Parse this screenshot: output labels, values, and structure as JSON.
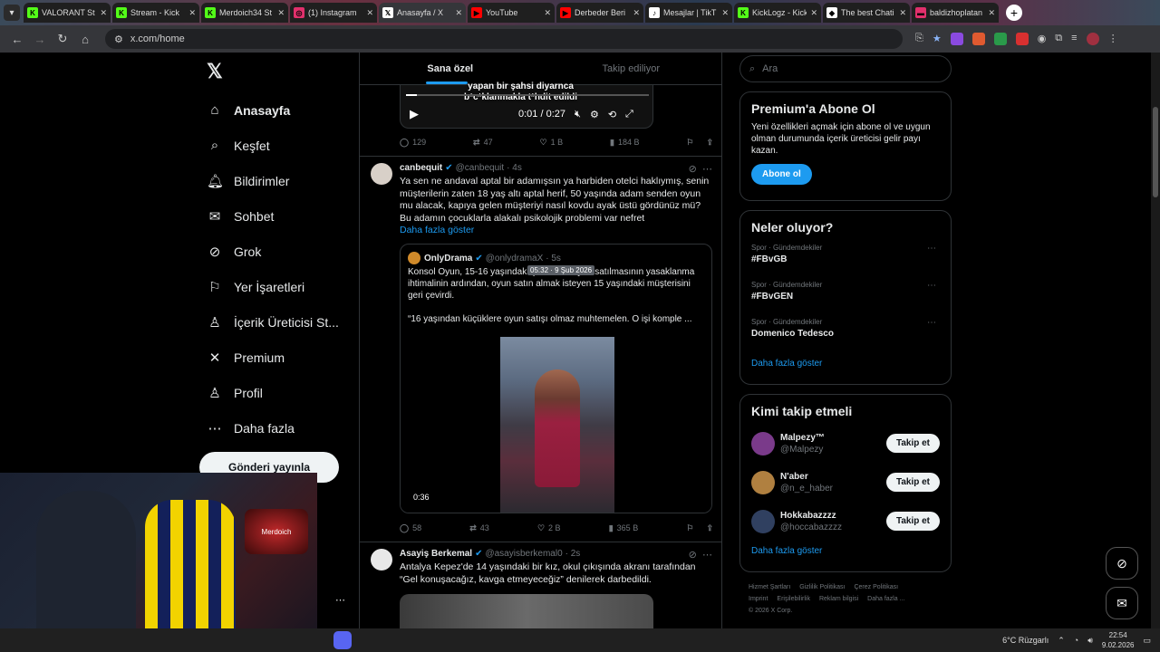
{
  "browser": {
    "tabs": [
      {
        "title": "VALORANT St",
        "color": "#53fc18",
        "glyph": "K",
        "active": false
      },
      {
        "title": "Stream - Kick",
        "color": "#53fc18",
        "glyph": "K",
        "active": false
      },
      {
        "title": "Merdoich34 St",
        "color": "#53fc18",
        "glyph": "K",
        "active": false
      },
      {
        "title": "(1) Instagram",
        "color": "#e1306c",
        "glyph": "◎",
        "active": false
      },
      {
        "title": "Anasayfa / X",
        "color": "#ffffff",
        "glyph": "𝕏",
        "active": true
      },
      {
        "title": "YouTube",
        "color": "#ff0000",
        "glyph": "▶",
        "active": false
      },
      {
        "title": "Derbeder Beri",
        "color": "#ff0000",
        "glyph": "▶",
        "active": false
      },
      {
        "title": "Mesajlar | TikT",
        "color": "#ffffff",
        "glyph": "♪",
        "active": false
      },
      {
        "title": "KickLogz - Kick",
        "color": "#53fc18",
        "glyph": "K",
        "active": false
      },
      {
        "title": "The best Chati",
        "color": "#ffffff",
        "glyph": "◆",
        "active": false
      },
      {
        "title": "baldizhoplatan",
        "color": "#e1306c",
        "glyph": "▬",
        "active": false
      }
    ],
    "url": "x.com/home"
  },
  "nav": {
    "items": [
      {
        "label": "Anasayfa",
        "icon": "home-icon",
        "glyph": "⌂",
        "bold": true
      },
      {
        "label": "Keşfet",
        "icon": "search-icon",
        "glyph": "⌕"
      },
      {
        "label": "Bildirimler",
        "icon": "bell-icon",
        "glyph": "🔔︎"
      },
      {
        "label": "Sohbet",
        "icon": "mail-icon",
        "glyph": "✉"
      },
      {
        "label": "Grok",
        "icon": "grok-icon",
        "glyph": "⊘"
      },
      {
        "label": "Yer İşaretleri",
        "icon": "bookmark-icon",
        "glyph": "⚐"
      },
      {
        "label": "İçerik Üreticisi St...",
        "icon": "creator-icon",
        "glyph": "♙"
      },
      {
        "label": "Premium",
        "icon": "x-icon",
        "glyph": "✕"
      },
      {
        "label": "Profil",
        "icon": "profile-icon",
        "glyph": "♙"
      },
      {
        "label": "Daha fazla",
        "icon": "more-icon",
        "glyph": "⋯"
      }
    ],
    "post_button": "Gönderi yayınla"
  },
  "feed": {
    "tabs": [
      "Sana özel",
      "Takip ediliyor"
    ],
    "top_video": {
      "caption_line1": "yapan bir şahsi diyarnca",
      "caption_line2": "b*c*klanmakla t*hdit edildi",
      "time": "0:01 / 0:27"
    },
    "post1_actions": {
      "replies": "129",
      "reposts": "47",
      "likes": "1 B",
      "views": "184 B"
    },
    "post2": {
      "name": "canbequit",
      "handle": "@canbequit",
      "time": "· 4s",
      "text": "Ya sen ne andaval aptal bir adamışsın ya harbiden otelci haklıymış, senin müşterilerin zaten 18 yaş altı aptal herif, 50 yaşında adam senden oyun mu alacak, kapıya gelen müşteriyi nasıl kovdu ayak üstü gördünüz mü? Bu adamın çocuklarla alakalı psikolojik problemi var nefret",
      "show_more": "Daha fazla göster",
      "quote": {
        "name": "OnlyDrama",
        "handle": "@onlydramaX",
        "time": "· 5s",
        "tooltip": "05:32 · 9 Şub 2026",
        "text1": "Konsol Oyun, 15-16 yaşındaki çocuklara oyun satılmasının yasaklanma ihtimalinin ardından, oyun satın almak isteyen 15 yaşındaki müşterisini geri çevirdi.",
        "text2": "“16 yaşından küçüklere oyun satışı olmaz muhtemelen. O işi komple ...",
        "duration": "0:36"
      },
      "actions": {
        "replies": "58",
        "reposts": "43",
        "likes": "2 B",
        "views": "365 B"
      }
    },
    "post3": {
      "name": "Asayiş Berkemal",
      "handle": "@asayisberkemal0",
      "time": "· 2s",
      "text": "Antalya Kepez'de 14 yaşındaki bir kız, okul çıkışında akranı tarafından “Gel konuşacağız, kavga etmeyeceğiz” denilerek darbedildi."
    }
  },
  "right": {
    "search_placeholder": "Ara",
    "premium": {
      "title": "Premium'a Abone Ol",
      "text": "Yeni özellikleri açmak için abone ol ve uygun olman durumunda içerik üreticisi gelir payı kazan.",
      "button": "Abone ol"
    },
    "trends": {
      "title": "Neler oluyor?",
      "items": [
        {
          "category": "Spor · Gündemdekiler",
          "topic": "#FBvGB"
        },
        {
          "category": "Spor · Gündemdekiler",
          "topic": "#FBvGEN"
        },
        {
          "category": "Spor · Gündemdekiler",
          "topic": "Domenico Tedesco"
        }
      ],
      "show_more": "Daha fazla göster"
    },
    "who_to_follow": {
      "title": "Kimi takip etmeli",
      "items": [
        {
          "name": "Malpezy™",
          "handle": "@Malpezy",
          "button": "Takip et",
          "color": "#7a3a8a"
        },
        {
          "name": "N'aber",
          "handle": "@n_e_haber",
          "button": "Takip et",
          "color": "#b08040"
        },
        {
          "name": "Hokkabazzzz",
          "handle": "@hoccabazzzz",
          "button": "Takip et",
          "color": "#304060"
        }
      ],
      "show_more": "Daha fazla göster"
    },
    "footer": {
      "line1": [
        "Hizmet Şartları",
        "Gizlilik Politikası",
        "Çerez Politikası"
      ],
      "line2": [
        "Imprint",
        "Erişilebilirlik",
        "Reklam bilgisi",
        "Daha fazla ..."
      ],
      "copyright": "© 2026 X Corp."
    }
  },
  "stream_overlay": {
    "sign_text": "Merdoich"
  },
  "taskbar": {
    "weather": "6°C  Rüzgarlı",
    "time": "22:54",
    "date": "9.02.2026"
  }
}
